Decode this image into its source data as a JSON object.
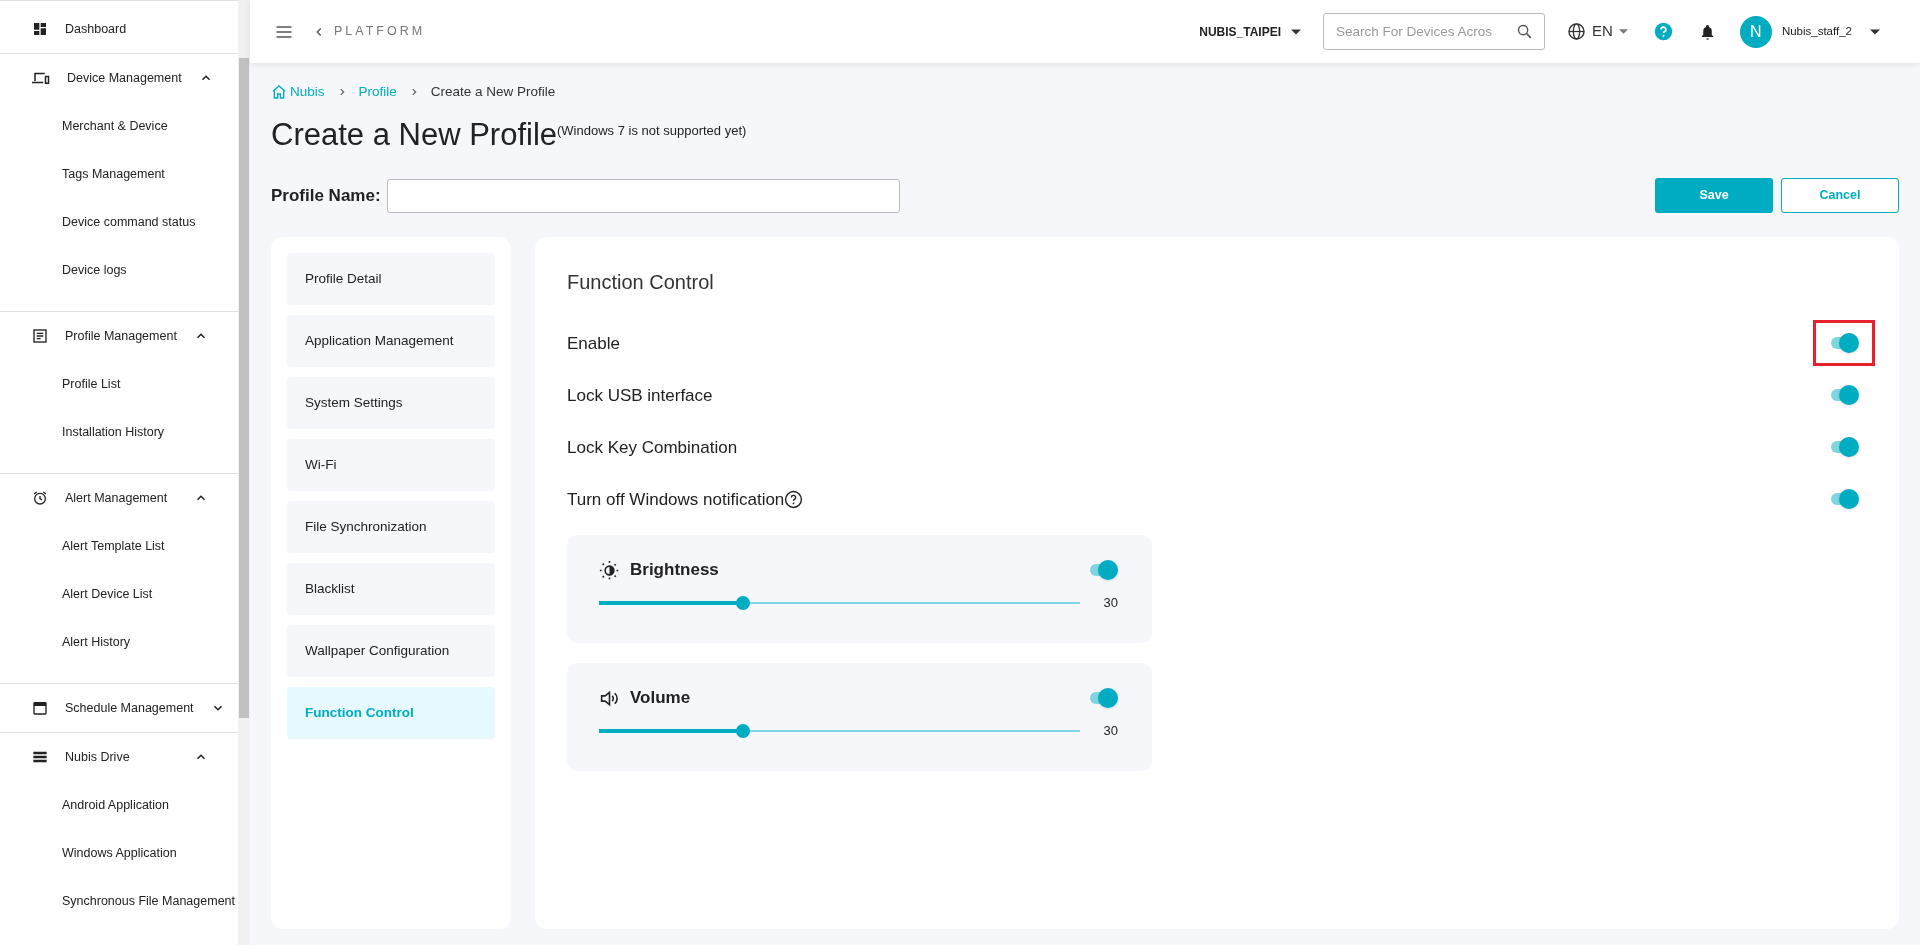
{
  "sidebar": {
    "groups": [
      {
        "label": "Dashboard"
      },
      {
        "label": "Device Management",
        "expanded": true,
        "children": [
          {
            "label": "Merchant & Device"
          },
          {
            "label": "Tags Management"
          },
          {
            "label": "Device command status"
          },
          {
            "label": "Device logs"
          }
        ]
      },
      {
        "label": "Profile Management",
        "expanded": true,
        "children": [
          {
            "label": "Profile List"
          },
          {
            "label": "Installation History"
          }
        ]
      },
      {
        "label": "Alert Management",
        "expanded": true,
        "children": [
          {
            "label": "Alert Template List"
          },
          {
            "label": "Alert Device List"
          },
          {
            "label": "Alert History"
          }
        ]
      },
      {
        "label": "Schedule Management",
        "expanded": false
      },
      {
        "label": "Nubis Drive",
        "expanded": true,
        "children": [
          {
            "label": "Android Application"
          },
          {
            "label": "Windows Application"
          },
          {
            "label": "Synchronous File Management"
          }
        ]
      }
    ]
  },
  "header": {
    "platform": "PLATFORM",
    "organization": "NUBIS_TAIPEI",
    "search": {
      "placeholder": "Search For Devices Acros"
    },
    "language": "EN",
    "avatar": "N",
    "user": "Nubis_staff_2"
  },
  "breadcrumb": [
    "Nubis",
    "Profile",
    "Create a New Profile"
  ],
  "title": "Create a New Profile",
  "subtitle": "(Windows 7 is not supported yet)",
  "profile_name": {
    "label": "Profile Name:"
  },
  "buttons": {
    "save": "Save",
    "cancel": "Cancel"
  },
  "tabs": [
    {
      "label": "Profile Detail",
      "selected": false
    },
    {
      "label": "Application Management",
      "selected": false
    },
    {
      "label": "System Settings",
      "selected": false
    },
    {
      "label": "Wi-Fi",
      "selected": false
    },
    {
      "label": "File Synchronization",
      "selected": false
    },
    {
      "label": "Blacklist",
      "selected": false
    },
    {
      "label": "Wallpaper Configuration",
      "selected": false
    },
    {
      "label": "Function Control",
      "selected": true
    }
  ],
  "section_title": "Function Control",
  "switches": [
    {
      "label": "Enable",
      "on": true,
      "highlighted": true
    },
    {
      "label": "Lock USB interface",
      "on": true,
      "highlighted": false
    },
    {
      "label": "Lock Key Combination",
      "on": true,
      "highlighted": false
    },
    {
      "label": "Turn off Windows notification",
      "on": true,
      "highlighted": false,
      "help": true
    }
  ],
  "sliders": [
    {
      "kind": "brightness",
      "label": "Brightness",
      "on": true,
      "level": 0.3,
      "reading": "30"
    },
    {
      "kind": "volume",
      "label": "Volume",
      "on": true,
      "level": 0.3,
      "reading": "30"
    }
  ]
}
